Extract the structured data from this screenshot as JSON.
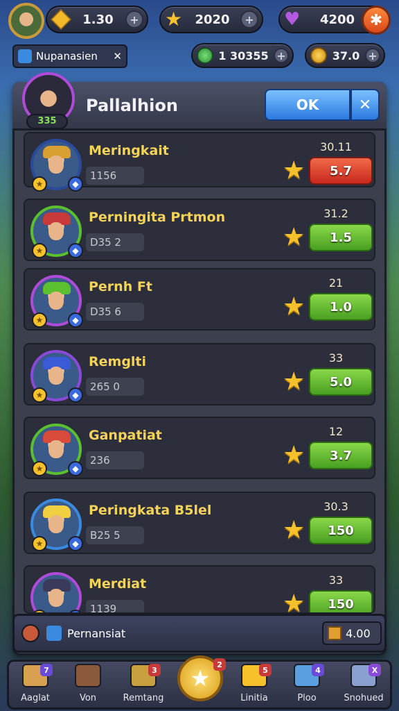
{
  "top_bar": {
    "gold": "1.30",
    "stars": "2020",
    "gems": "4200"
  },
  "second_bar": {
    "chip_label": "Nupanasien",
    "resource_a": "1 30355",
    "resource_b": "37.0"
  },
  "panel": {
    "title": "Pallalhion",
    "ok_label": "OK",
    "close_label": "✕",
    "header_badge": "335"
  },
  "rows": [
    {
      "name": "Meringkait",
      "stat": "1156",
      "score": "30.11",
      "button": "5.7",
      "button_color": "#d8301e"
    },
    {
      "name": "Perningita Prtmon",
      "stat": "D35 2",
      "score": "31.2",
      "button": "1.5",
      "button_color": "#5cb830"
    },
    {
      "name": "Pernh Ft",
      "stat": "D35 6",
      "score": "21",
      "button": "1.0",
      "button_color": "#5cb830"
    },
    {
      "name": "Remglti",
      "stat": "265 0",
      "score": "33",
      "button": "5.0",
      "button_color": "#5cb830"
    },
    {
      "name": "Ganpatiat",
      "stat": "236",
      "score": "12",
      "button": "3.7",
      "button_color": "#5cb830"
    },
    {
      "name": "Peringkata B5lel",
      "stat": "B25 5",
      "score": "30.3",
      "button": "150",
      "button_color": "#5cb830"
    },
    {
      "name": "Merdiat",
      "stat": "1139",
      "score": "33",
      "button": "150",
      "button_color": "#5cb830"
    }
  ],
  "footer": {
    "label": "Pernansiat",
    "value": "4.00"
  },
  "nav": [
    {
      "label": "Aaglat",
      "icon": "chest-icon",
      "badge": "7"
    },
    {
      "label": "Von",
      "icon": "shop-icon",
      "badge": ""
    },
    {
      "label": "Remtang",
      "icon": "hammer-icon",
      "badge": "3"
    },
    {
      "label": "",
      "icon": "center-star-icon",
      "badge": "2"
    },
    {
      "label": "Linitia",
      "icon": "star-icon",
      "badge": "5"
    },
    {
      "label": "Ploo",
      "icon": "cube-icon",
      "badge": "4"
    },
    {
      "label": "Snohued",
      "icon": "menu-icon",
      "badge": "X"
    }
  ]
}
